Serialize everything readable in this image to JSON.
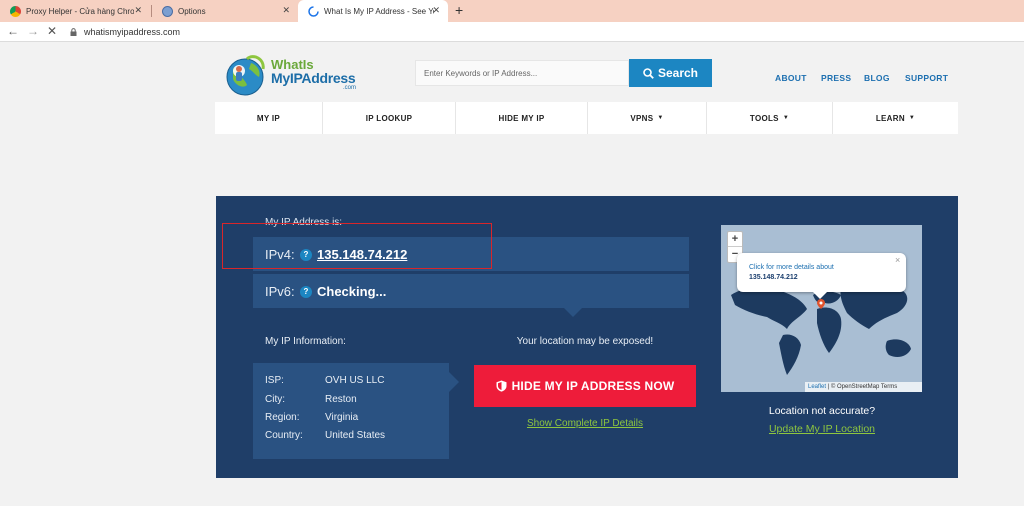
{
  "browser": {
    "tabs": [
      {
        "title": "Proxy Helper - Cửa hàng Chrome",
        "active": false
      },
      {
        "title": "Options",
        "active": false
      },
      {
        "title": "What Is My IP Address - See Your",
        "active": true
      }
    ],
    "url": "whatismyipaddress.com"
  },
  "header": {
    "logo": {
      "line1": "WhatIs",
      "line2": "MyIPAddress",
      "line3": ".com"
    },
    "search": {
      "placeholder": "Enter Keywords or IP Address...",
      "button_label": "Search"
    },
    "top_links": [
      "ABOUT",
      "PRESS",
      "BLOG",
      "SUPPORT"
    ]
  },
  "nav": {
    "items": [
      {
        "label": "MY IP",
        "dropdown": false
      },
      {
        "label": "IP LOOKUP",
        "dropdown": false
      },
      {
        "label": "HIDE MY IP",
        "dropdown": false
      },
      {
        "label": "VPNS",
        "dropdown": true
      },
      {
        "label": "TOOLS",
        "dropdown": true
      },
      {
        "label": "LEARN",
        "dropdown": true
      }
    ],
    "caret": "▼"
  },
  "ip_panel": {
    "heading": "My IP Address is:",
    "ipv4_label": "IPv4:",
    "ipv4_value": "135.148.74.212",
    "ipv6_label": "IPv6:",
    "ipv6_value": "Checking...",
    "help_glyph": "?",
    "info_heading": "My IP Information:",
    "info": [
      {
        "key": "ISP:",
        "value": "OVH US LLC"
      },
      {
        "key": "City:",
        "value": "Reston"
      },
      {
        "key": "Region:",
        "value": "Virginia"
      },
      {
        "key": "Country:",
        "value": "United States"
      }
    ],
    "exposed_text": "Your location may be exposed!",
    "hide_button": "HIDE MY IP ADDRESS NOW",
    "details_link": "Show Complete IP Details"
  },
  "map": {
    "zoom_in": "+",
    "zoom_out": "−",
    "popup_line1": "Click for more details about",
    "popup_line2": "135.148.74.212",
    "popup_close": "×",
    "attribution_leaflet": "Leaflet",
    "attribution_rest": "| © OpenStreetMap Terms",
    "location_question": "Location not accurate?",
    "update_link": "Update My IP Location"
  },
  "colors": {
    "panel_bg": "#1f3e68",
    "row_bg": "#2a5282",
    "accent_blue": "#1c86c2",
    "hide_red": "#ee1c3a",
    "link_green": "#8ec63f",
    "highlight_red": "#d9262a"
  },
  "icons": [
    "chrome-tab-icon",
    "options-tab-icon",
    "loading-spinner-icon",
    "back-arrow-icon",
    "forward-arrow-icon",
    "stop-icon",
    "lock-icon",
    "search-icon",
    "shield-icon",
    "map-marker-icon"
  ]
}
